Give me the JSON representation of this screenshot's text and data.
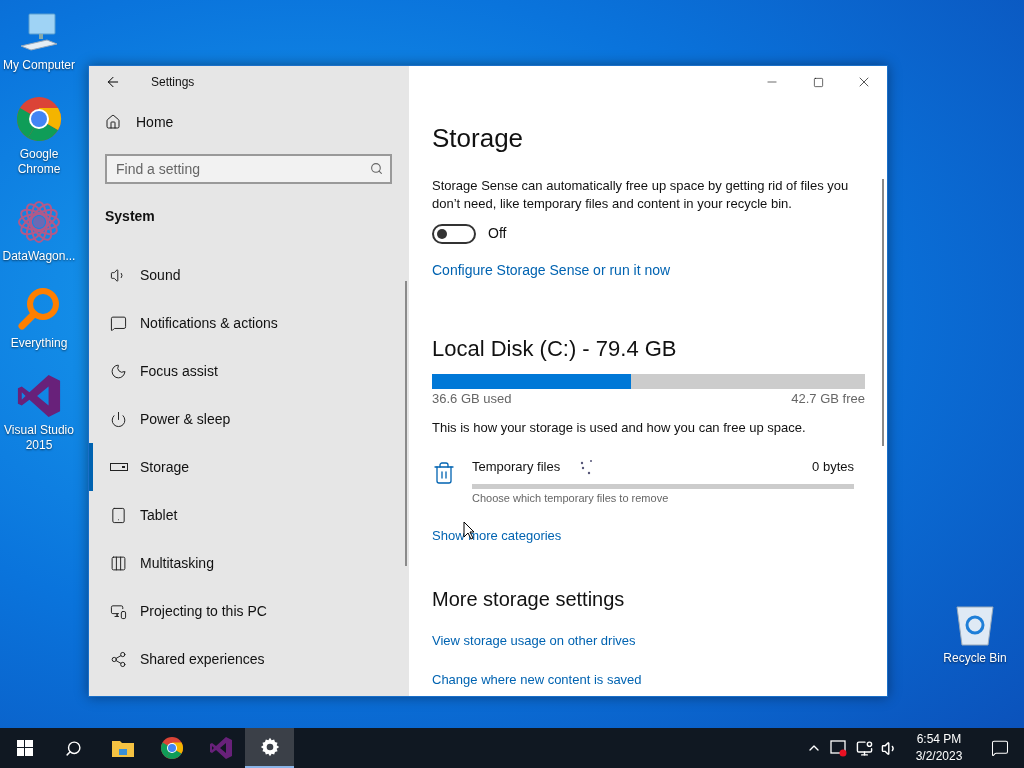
{
  "desktop_icons": [
    {
      "kind": "computer",
      "label": "My Computer"
    },
    {
      "kind": "chrome",
      "label": "Google Chrome"
    },
    {
      "kind": "datawagon",
      "label": "DataWagon..."
    },
    {
      "kind": "everything",
      "label": "Everything"
    },
    {
      "kind": "visualstudio",
      "label": "Visual Studio 2015"
    },
    {
      "kind": "recycle",
      "label": "Recycle Bin"
    }
  ],
  "window": {
    "title": "Settings",
    "nav": {
      "home": "Home",
      "search": {
        "placeholder": "Find a setting"
      },
      "section": "System",
      "items": [
        {
          "kind": "sound",
          "label": "Sound",
          "selected": false
        },
        {
          "kind": "notifications",
          "label": "Notifications & actions",
          "selected": false
        },
        {
          "kind": "focus",
          "label": "Focus assist",
          "selected": false
        },
        {
          "kind": "power",
          "label": "Power & sleep",
          "selected": false
        },
        {
          "kind": "storage",
          "label": "Storage",
          "selected": true
        },
        {
          "kind": "tablet",
          "label": "Tablet",
          "selected": false
        },
        {
          "kind": "multitasking",
          "label": "Multitasking",
          "selected": false
        },
        {
          "kind": "projecting",
          "label": "Projecting to this PC",
          "selected": false
        },
        {
          "kind": "shared",
          "label": "Shared experiences",
          "selected": false
        }
      ]
    },
    "content": {
      "heading": "Storage",
      "description": "Storage Sense can automatically free up space by getting rid of files you don’t need, like temporary files and content in your recycle bin.",
      "storage_sense": {
        "on": false,
        "label": "Off"
      },
      "configure_link": "Configure Storage Sense or run it now",
      "disk": {
        "title": "Local Disk (C:) - 79.4 GB",
        "level": 0.46,
        "used": "36.6 GB used",
        "free": "42.7 GB free"
      },
      "usage_note": "This is how your storage is used and how you can free up space.",
      "categories": [
        {
          "name": "Temporary files",
          "size": "0 bytes",
          "description": "Choose which temporary files to remove"
        }
      ],
      "show_more_link": "Show more categories",
      "more_heading": "More storage settings",
      "more_links": [
        "View storage usage on other drives",
        "Change where new content is saved"
      ]
    }
  },
  "taskbar": {
    "apps": [
      {
        "kind": "explorer",
        "selected": false
      },
      {
        "kind": "chrome",
        "selected": false
      },
      {
        "kind": "visualstudio",
        "selected": false
      },
      {
        "kind": "settings",
        "selected": true
      }
    ],
    "time": "6:54 PM",
    "date": "3/2/2023"
  }
}
